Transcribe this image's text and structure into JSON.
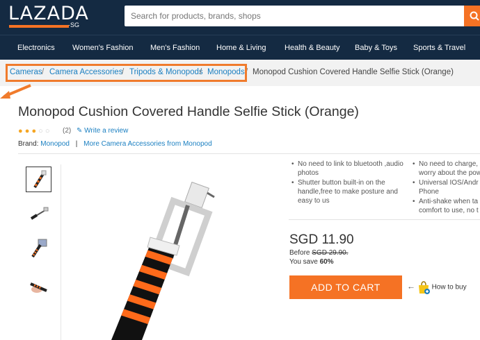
{
  "header": {
    "logo_text": "LAZADA",
    "logo_suffix": "·SG",
    "search_placeholder": "Search for products, brands, shops",
    "search_icon": "search-icon"
  },
  "categories": [
    "Electronics",
    "Women's Fashion",
    "Men's Fashion",
    "Home & Living",
    "Health & Beauty",
    "Baby & Toys",
    "Sports & Travel"
  ],
  "breadcrumb": {
    "items": [
      "Cameras",
      "Camera Accessories",
      "Tripods & Monopods",
      "Monopods"
    ],
    "separator": "/",
    "current": "Monopod Cushion Covered Handle Selfie Stick (Orange)"
  },
  "product": {
    "title": "Monopod Cushion Covered Handle Selfie Stick (Orange)",
    "rating_stars": 3,
    "rating_max": 5,
    "rating_count": "(2)",
    "write_review": "Write a review",
    "brand_label": "Brand:",
    "brand_name": "Monopod",
    "brand_sep": "|",
    "more_from": "More Camera Accessories from Monopod"
  },
  "features": {
    "col1": [
      "No need to link to bluetooth ,audio photos",
      "Shutter button built-in on the handle,free to make posture and easy to us"
    ],
    "col2": [
      "No need to charge, worry about the pow",
      "Universal IOS/Andr Phone",
      "Anti-shake when ta comfort to use, no t"
    ]
  },
  "pricing": {
    "price": "SGD 11.90",
    "before_label": "Before",
    "before_price": "SGD 29.90.",
    "save_label": "You save",
    "save_value": "60%"
  },
  "actions": {
    "add_to_cart": "ADD TO CART",
    "how_to_buy": "How to buy"
  },
  "colors": {
    "header_bg": "#142a42",
    "accent": "#f57224",
    "link": "#1a7fc1",
    "highlight_box": "#f07b2c"
  }
}
